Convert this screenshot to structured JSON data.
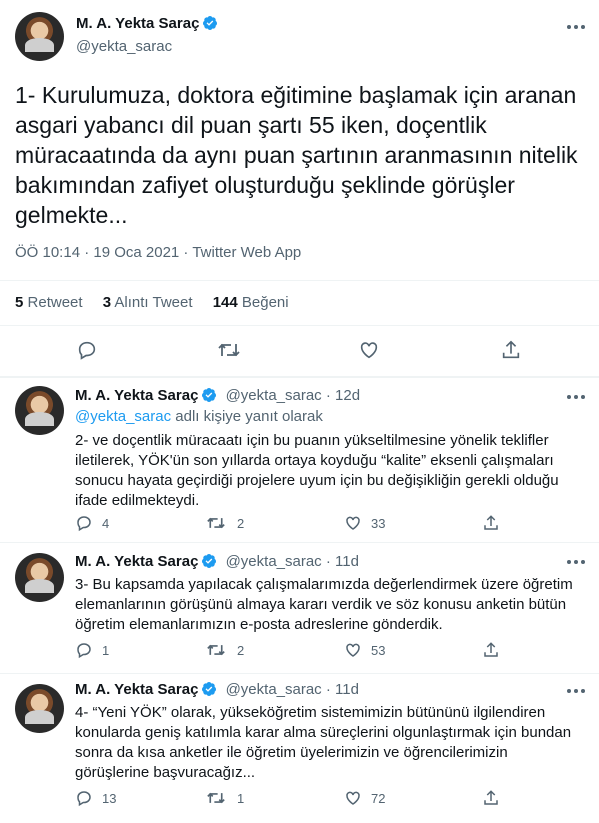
{
  "main_tweet": {
    "name": "M. A. Yekta Saraç",
    "handle": "@yekta_sarac",
    "text": "1- Kurulumuza, doktora eğitimine başlamak için aranan asgari yabancı dil puan şartı 55 iken, doçentlik müracaatında da aynı puan şartının aranmasının nitelik bakımından zafiyet oluşturduğu şeklinde görüşler gelmekte...",
    "meta": "ÖÖ 10:14 · 19 Oca 2021 · Twitter Web App",
    "stats": {
      "retweets_count": "5",
      "retweets_label": "Retweet",
      "quotes_count": "3",
      "quotes_label": "Alıntı Tweet",
      "likes_count": "144",
      "likes_label": "Beğeni"
    }
  },
  "replies": [
    {
      "name": "M. A. Yekta Saraç",
      "handle": "@yekta_sarac",
      "time": "12d",
      "replying_handle": "@yekta_sarac",
      "replying_label": "adlı kişiye yanıt olarak",
      "text": "2- ve doçentlik müracaatı için bu puanın yükseltilmesine yönelik teklifler iletilerek, YÖK'ün son yıllarda ortaya koyduğu “kalite” eksenli çalışmaları sonucu hayata geçirdiği projelere uyum için bu değişikliğin gerekli olduğu ifade edilmekteydi.",
      "reply_count": "4",
      "retweet_count": "2",
      "like_count": "33"
    },
    {
      "name": "M. A. Yekta Saraç",
      "handle": "@yekta_sarac",
      "time": "11d",
      "text": "3- Bu kapsamda yapılacak çalışmalarımızda değerlendirmek üzere öğretim elemanlarının görüşünü almaya kararı verdik ve söz konusu anketin bütün öğretim elemanlarımızın e-posta adreslerine gönderdik.",
      "reply_count": "1",
      "retweet_count": "2",
      "like_count": "53"
    },
    {
      "name": "M. A. Yekta Saraç",
      "handle": "@yekta_sarac",
      "time": "11d",
      "text": "4- “Yeni YÖK” olarak, yükseköğretim sistemimizin bütününü ilgilendiren konularda geniş katılımla karar alma süreçlerini olgunlaştırmak için bundan sonra da kısa anketler ile öğretim üyelerimizin ve öğrencilerimizin görüşlerine başvuracağız...",
      "reply_count": "13",
      "retweet_count": "1",
      "like_count": "72"
    }
  ],
  "icons": {
    "verified": "verified-badge-icon",
    "more": "more-dots-icon",
    "reply": "reply-icon",
    "retweet": "retweet-icon",
    "like": "heart-icon",
    "share": "share-icon"
  },
  "colors": {
    "text": "#0f1419",
    "secondary": "#536471",
    "accent": "#1d9bf0",
    "divider": "#eff3f4"
  }
}
